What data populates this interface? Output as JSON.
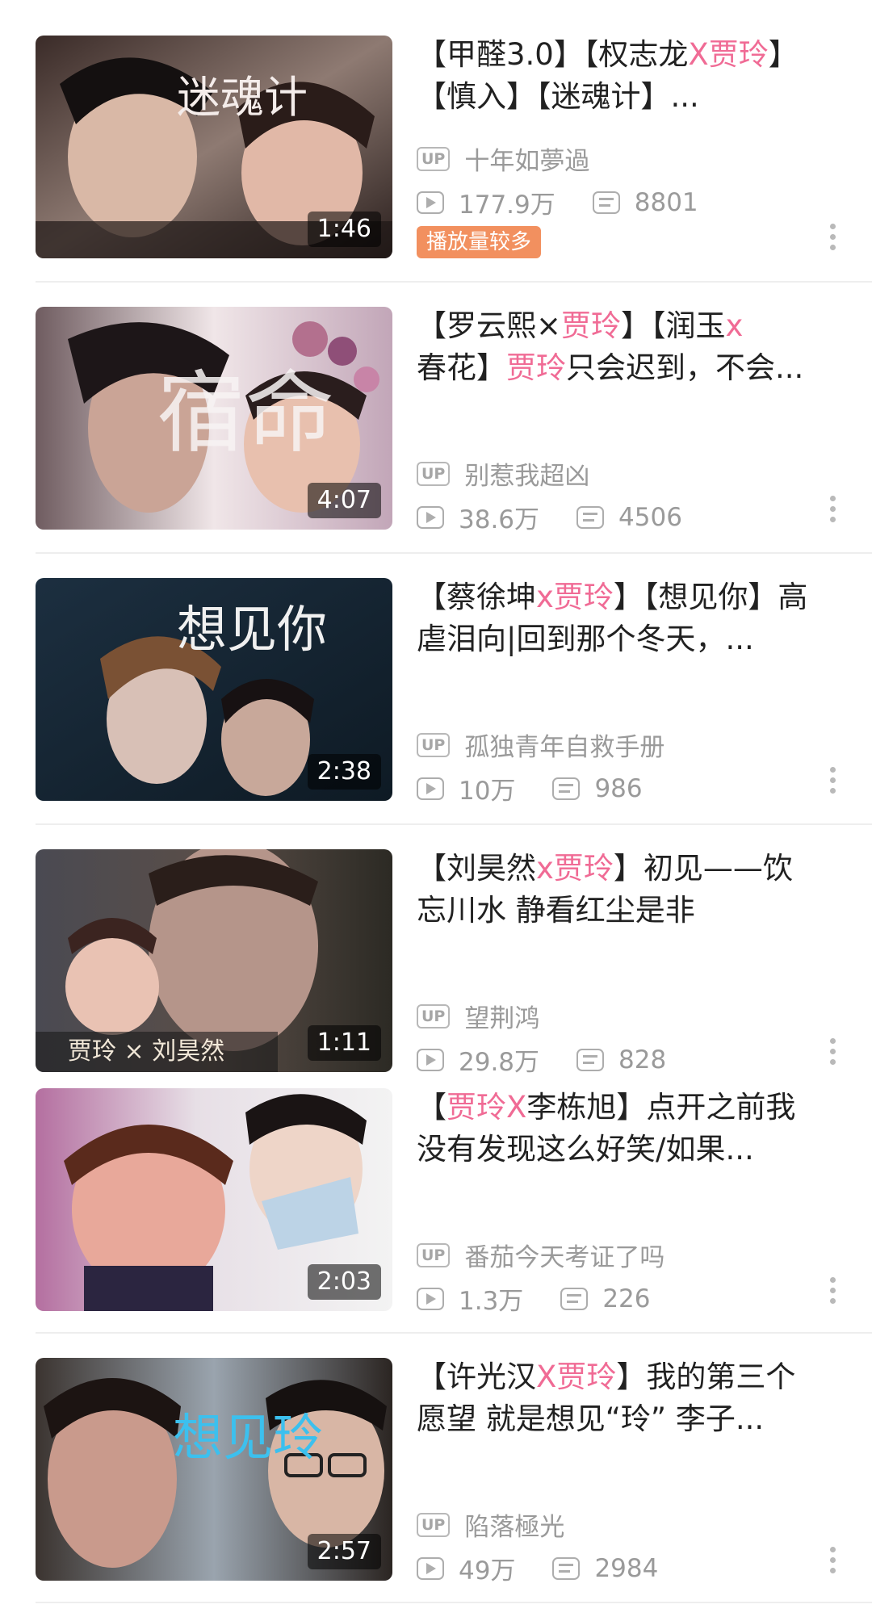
{
  "videos": [
    {
      "title_parts": [
        {
          "text": "【甲醛3.0】【权志龙",
          "hl": false
        },
        {
          "text": "X贾玲",
          "hl": true
        },
        {
          "text": "】【慎入】【迷魂计】...",
          "hl": false
        }
      ],
      "uploader": "十年如夢過",
      "views": "177.9万",
      "danmaku": "8801",
      "duration": "1:46",
      "badge": "播放量较多",
      "thumb_text": "迷魂计"
    },
    {
      "title_parts": [
        {
          "text": "【罗云熙×",
          "hl": false
        },
        {
          "text": "贾玲",
          "hl": true
        },
        {
          "text": "】【润玉",
          "hl": false
        },
        {
          "text": "x",
          "hl": true
        },
        {
          "text": "春花】",
          "hl": false
        },
        {
          "text": "贾玲",
          "hl": true
        },
        {
          "text": "只会迟到，不会...",
          "hl": false
        }
      ],
      "uploader": "别惹我超凶",
      "views": "38.6万",
      "danmaku": "4506",
      "duration": "4:07",
      "badge": null,
      "thumb_text": "宿命"
    },
    {
      "title_parts": [
        {
          "text": "【蔡徐坤",
          "hl": false
        },
        {
          "text": "x贾玲",
          "hl": true
        },
        {
          "text": "】【想见你】高虐泪向|回到那个冬天，...",
          "hl": false
        }
      ],
      "uploader": "孤独青年自救手册",
      "views": "10万",
      "danmaku": "986",
      "duration": "2:38",
      "badge": null,
      "thumb_text": "想见你"
    },
    {
      "title_parts": [
        {
          "text": "【刘昊然",
          "hl": false
        },
        {
          "text": "x贾玲",
          "hl": true
        },
        {
          "text": "】初见——饮忘川水 静看红尘是非",
          "hl": false
        }
      ],
      "uploader": "望荆鸿",
      "views": "29.8万",
      "danmaku": "828",
      "duration": "1:11",
      "badge": null,
      "thumb_text": "贾玲 × 刘昊然"
    },
    {
      "title_parts": [
        {
          "text": "【",
          "hl": false
        },
        {
          "text": "贾玲X",
          "hl": true
        },
        {
          "text": "李栋旭】点开之前我没有发现这么好笑/如果...",
          "hl": false
        }
      ],
      "uploader": "番茄今天考证了吗",
      "views": "1.3万",
      "danmaku": "226",
      "duration": "2:03",
      "badge": null,
      "thumb_text": ""
    },
    {
      "title_parts": [
        {
          "text": "【许光汉",
          "hl": false
        },
        {
          "text": "X贾玲",
          "hl": true
        },
        {
          "text": "】我的第三个愿望 就是想见“玲” 李子...",
          "hl": false
        }
      ],
      "uploader": "陷落極光",
      "views": "49万",
      "danmaku": "2984",
      "duration": "2:57",
      "badge": null,
      "thumb_text": "想见玲"
    }
  ],
  "colors": {
    "highlight": "#f06b95",
    "badge_bg": "#f2905f",
    "meta_text": "#9a9a9a"
  },
  "icons": {
    "uploader": "up-badge-icon",
    "views": "play-icon",
    "danmaku": "danmaku-icon",
    "more": "more-vertical-icon"
  },
  "up_label": "UP"
}
